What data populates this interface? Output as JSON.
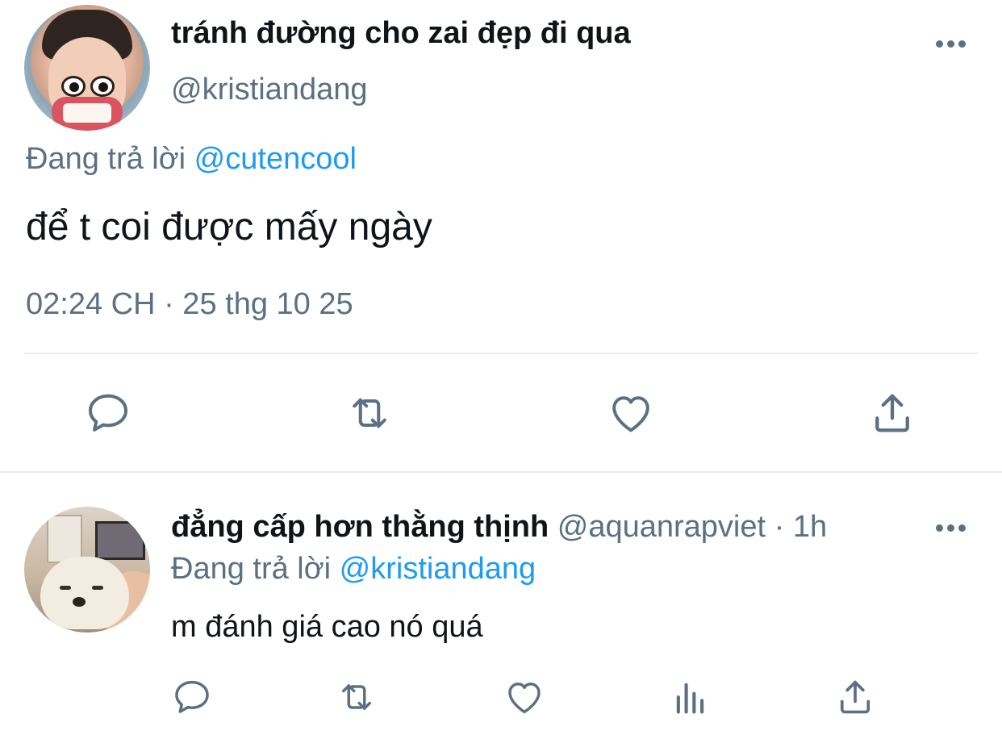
{
  "main_tweet": {
    "display_name": "tránh đường cho zai đẹp đi qua",
    "handle": "@kristiandang",
    "replying_prefix": "Đang trả lời",
    "replying_to": "@cutencool",
    "text": "để t coi được mấy ngày",
    "timestamp": "02:24 CH · 25 thg 10 25",
    "actions": [
      "reply-icon",
      "retweet-icon",
      "like-icon",
      "share-icon"
    ]
  },
  "reply_tweet": {
    "display_name": "đẳng cấp hơn thằng thịnh",
    "handle": "@aquanrapviet",
    "separator": "·",
    "time": "1h",
    "replying_prefix": "Đang trả lời",
    "replying_to": "@kristiandang",
    "text": "m đánh giá cao nó quá",
    "actions": [
      "reply-icon",
      "retweet-icon",
      "like-icon",
      "analytics-icon",
      "share-icon"
    ]
  },
  "colors": {
    "text_primary": "#0f1419",
    "text_secondary": "#5b7083",
    "mention": "#1d9bf0",
    "divider": "#e6ecf0"
  }
}
